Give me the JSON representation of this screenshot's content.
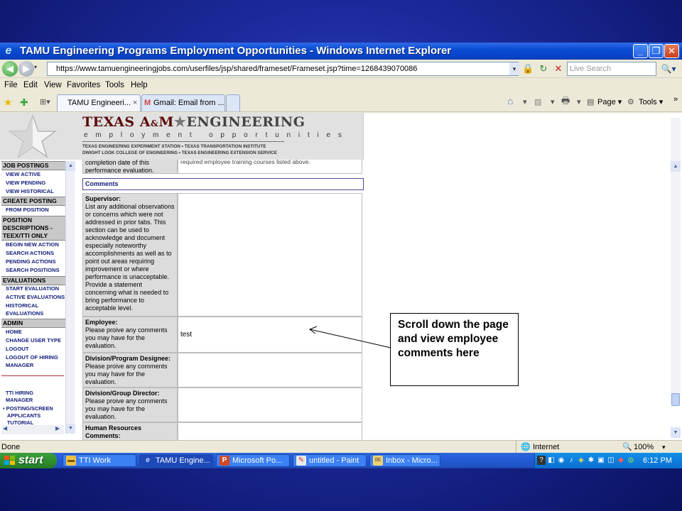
{
  "window": {
    "title": "TAMU Engineering Programs Employment Opportunities - Windows Internet Explorer"
  },
  "address": {
    "url": "https://www.tamuengineeringjobs.com/userfiles/jsp/shared/frameset/Frameset.jsp?time=1268439070086",
    "search_placeholder": "Live Search"
  },
  "menu": [
    "File",
    "Edit",
    "View",
    "Favorites",
    "Tools",
    "Help"
  ],
  "tabs": [
    {
      "label": "TAMU Engineeri...",
      "close": "×"
    },
    {
      "label": "Gmail: Email from ..."
    }
  ],
  "command_bar": {
    "page": "Page",
    "tools": "Tools",
    "more": "»"
  },
  "header": {
    "brand_a": "TEXAS A",
    "brand_amp": "&",
    "brand_m": "M",
    "brand_star": "★",
    "brand_eng": "ENGINEERING",
    "tagline": "employment opportunities",
    "line3": "TEXAS ENGINEERING EXPERIMENT STATION • TEXAS TRANSPORTATION INSTITUTE",
    "line4": "DWIGHT LOOK COLLEGE OF ENGINEERING • TEXAS ENGINEERING EXTENSION SERVICE"
  },
  "sidebar": {
    "job_postings": "JOB POSTINGS",
    "view_active": "VIEW ACTIVE",
    "view_pending": "VIEW PENDING",
    "view_historical": "VIEW HISTORICAL",
    "create_posting": "CREATE POSTING",
    "from_position": "FROM POSITION",
    "position_desc_1": "POSITION",
    "position_desc_2": "DESCRIPTIONS -",
    "position_desc_3": "TEEX/TTI ONLY",
    "begin_new_action": "BEGIN NEW ACTION",
    "search_actions": "SEARCH ACTIONS",
    "pending_actions": "PENDING ACTIONS",
    "search_positions": "SEARCH POSITIONS",
    "evaluations": "EVALUATIONS",
    "start_evaluation": "START EVALUATION",
    "active_evaluations": "ACTIVE EVALUATIONS",
    "historical_1": "HISTORICAL",
    "historical_2": "EVALUATIONS",
    "admin": "ADMIN",
    "home": "HOME",
    "change_user_type": "CHANGE USER TYPE",
    "logout": "LOGOUT",
    "logout_hiring_1": "LOGOUT OF HIRING",
    "logout_hiring_2": "MANAGER",
    "tti_1": "TTI HIRING",
    "tti_2": "MANAGER",
    "posting_1": "• POSTING/SCREEN",
    "posting_2": "APPLICANTS",
    "posting_3": "TUTORIAL"
  },
  "form": {
    "partial_left": "completion date of this performance evaluation.",
    "partial_right": "required employee training courses listed above.",
    "comments_header": "Comments",
    "supervisor_title": "Supervisor:",
    "supervisor_text": "List any additional observations or concerns which were not addressed in prior tabs. This section can be used to acknowledge and document especially noteworthy accomplishments as well as to point out areas requiring improvement or where performance is unacceptable. Provide a statement concerning what is needed to bring performance to acceptable level.",
    "employee_title": "Employee:",
    "employee_text": "Please proive any comments you may have for the evaluation.",
    "employee_comment": "test",
    "division_title": "Division/Program Designee:",
    "division_text": "Please proive any comments you may have for the evaluation.",
    "group_title": "Division/Group Director:",
    "group_text": "Please proive any comments you may have for the evaluation.",
    "hr_title": "Human Resources Comments:"
  },
  "callout": {
    "text": "Scroll down the page and view employee comments here"
  },
  "status": {
    "left": "Done",
    "zone": "Internet",
    "zoom": "100%"
  },
  "taskbar": {
    "start": "start",
    "items": [
      "TTI Work",
      "TAMU Engine...",
      "Microsoft Po...",
      "untitled - Paint",
      "Inbox - Micro..."
    ],
    "clock": "6:12 PM"
  }
}
